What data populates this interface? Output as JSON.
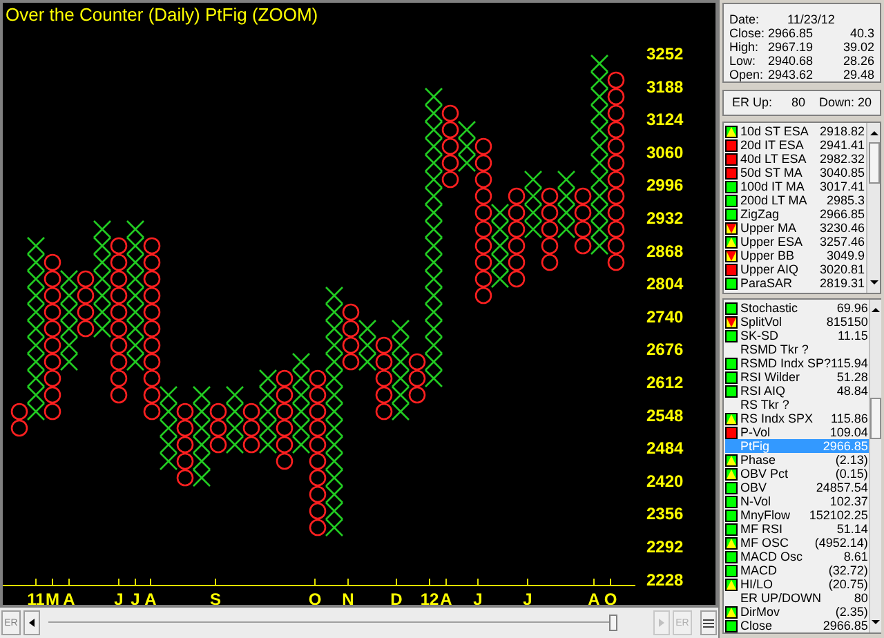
{
  "chart": {
    "title": "Over the Counter (Daily) PtFig (ZOOM)",
    "y_labels": [
      "3252",
      "3188",
      "3124",
      "3060",
      "2996",
      "2932",
      "2868",
      "2804",
      "2740",
      "2676",
      "2612",
      "2548",
      "2484",
      "2420",
      "2356",
      "2292",
      "2228"
    ],
    "x_labels": [
      "11",
      "M",
      "A",
      "J",
      "J",
      "A",
      "S",
      "O",
      "N",
      "D",
      "12",
      "A",
      "J",
      "J",
      "A",
      "O"
    ]
  },
  "scrollbar": {
    "left_button": "ER",
    "right_button": "ER"
  },
  "quote": {
    "date_label": "Date:",
    "date": "11/23/12",
    "rows": [
      {
        "label": "Close:",
        "value": "2966.85",
        "change": "40.3"
      },
      {
        "label": "High:",
        "value": "2967.19",
        "change": "39.02"
      },
      {
        "label": "Low:",
        "value": "2940.68",
        "change": "28.26"
      },
      {
        "label": "Open:",
        "value": "2943.62",
        "change": "29.48"
      }
    ]
  },
  "er": {
    "up_label": "ER Up:",
    "up": "80",
    "down_label": "Down:",
    "down": "20"
  },
  "indicator_lists": [
    {
      "items": [
        {
          "name": "10d ST ESA",
          "value": "2918.82",
          "kind": "up",
          "selected": false
        },
        {
          "name": "20d IT ESA",
          "value": "2941.41",
          "kind": "red",
          "selected": false
        },
        {
          "name": "40d LT ESA",
          "value": "2982.32",
          "kind": "red",
          "selected": false
        },
        {
          "name": "50d ST MA",
          "value": "3040.85",
          "kind": "red",
          "selected": false
        },
        {
          "name": "100d IT MA",
          "value": "3017.41",
          "kind": "green",
          "selected": false
        },
        {
          "name": "200d LT MA",
          "value": "2985.3",
          "kind": "green",
          "selected": false
        },
        {
          "name": "ZigZag",
          "value": "2966.85",
          "kind": "green",
          "selected": false
        },
        {
          "name": "Upper MA",
          "value": "3230.46",
          "kind": "down",
          "selected": false
        },
        {
          "name": "Upper ESA",
          "value": "3257.46",
          "kind": "up",
          "selected": false
        },
        {
          "name": "Upper BB",
          "value": "3049.9",
          "kind": "down",
          "selected": false
        },
        {
          "name": "Upper AIQ",
          "value": "3020.81",
          "kind": "red",
          "selected": false
        },
        {
          "name": "ParaSAR",
          "value": "2819.31",
          "kind": "green",
          "selected": false
        }
      ]
    },
    {
      "items": [
        {
          "name": "Stochastic",
          "value": "69.96",
          "kind": "green",
          "selected": false
        },
        {
          "name": "SplitVol",
          "value": "815150",
          "kind": "down",
          "selected": false
        },
        {
          "name": "SK-SD",
          "value": "11.15",
          "kind": "green",
          "selected": false
        },
        {
          "name": "RSMD Tkr ?",
          "kind": "none",
          "selected": false
        },
        {
          "name": "RSMD Indx SP?",
          "value": "115.94",
          "kind": "green",
          "selected": false
        },
        {
          "name": "RSI Wilder",
          "value": "51.28",
          "kind": "green",
          "selected": false
        },
        {
          "name": "RSI AIQ",
          "value": "48.84",
          "kind": "green",
          "selected": false
        },
        {
          "name": "RS Tkr ?",
          "kind": "none",
          "selected": false
        },
        {
          "name": "RS Indx SPX",
          "value": "115.86",
          "kind": "up",
          "selected": false
        },
        {
          "name": "P-Vol",
          "value": "109.04",
          "kind": "red",
          "selected": false
        },
        {
          "name": "PtFig",
          "value": "2966.85",
          "kind": "none",
          "selected": true
        },
        {
          "name": "Phase",
          "value": "(2.13)",
          "kind": "up",
          "selected": false
        },
        {
          "name": "OBV Pct",
          "value": "(0.15)",
          "kind": "up",
          "selected": false
        },
        {
          "name": "OBV",
          "value": "24857.54",
          "kind": "green",
          "selected": false
        },
        {
          "name": "N-Vol",
          "value": "102.37",
          "kind": "green",
          "selected": false
        },
        {
          "name": "MnyFlow",
          "value": "152102.25",
          "kind": "green",
          "selected": false
        },
        {
          "name": "MF RSI",
          "value": "51.14",
          "kind": "green",
          "selected": false
        },
        {
          "name": "MF OSC",
          "value": "(4952.14)",
          "kind": "up",
          "selected": false
        },
        {
          "name": "MACD Osc",
          "value": "8.61",
          "kind": "green",
          "selected": false
        },
        {
          "name": "MACD",
          "value": "(32.72)",
          "kind": "green",
          "selected": false
        },
        {
          "name": "HI/LO",
          "value": "(20.75)",
          "kind": "up",
          "selected": false
        },
        {
          "name": "ER UP/DOWN",
          "value": "80",
          "kind": "none",
          "selected": false
        },
        {
          "name": "DirMov",
          "value": "(2.35)",
          "kind": "up",
          "selected": false
        },
        {
          "name": "Close",
          "value": "2966.85",
          "kind": "green",
          "selected": false
        }
      ]
    }
  ]
}
